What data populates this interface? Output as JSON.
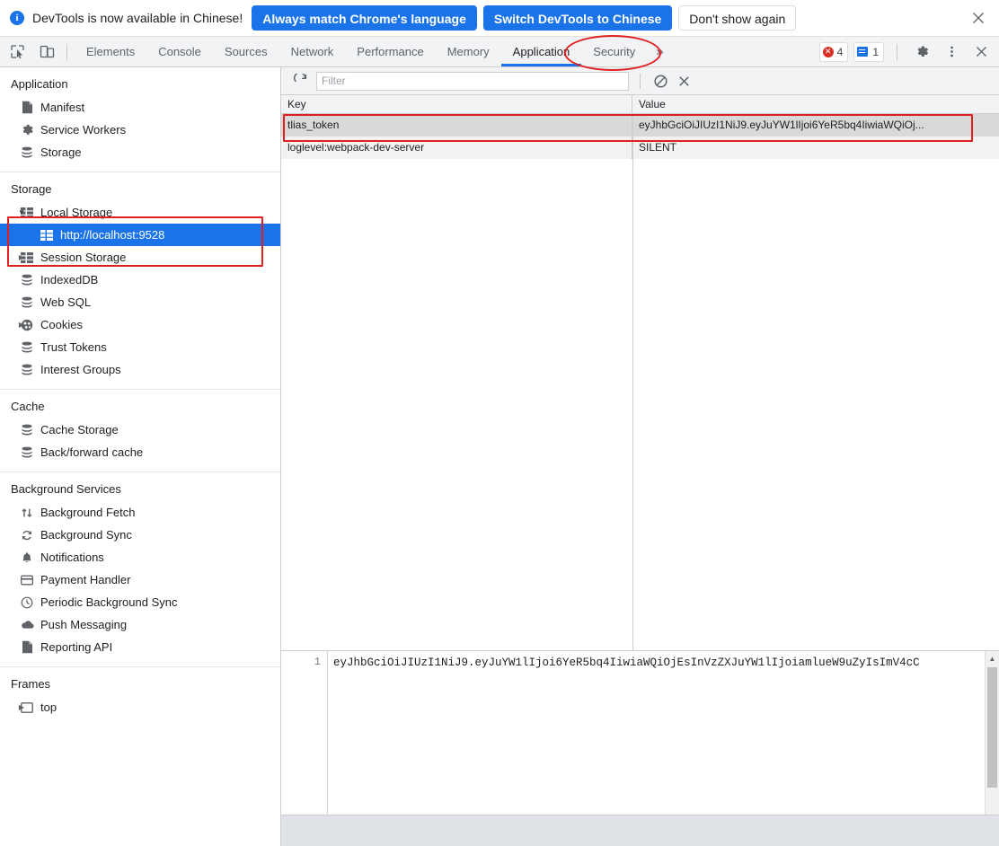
{
  "notification": {
    "icon": "info-icon",
    "message": "DevTools is now available in Chinese!",
    "buttons": [
      {
        "label": "Always match Chrome's language",
        "style": "primary"
      },
      {
        "label": "Switch DevTools to Chinese",
        "style": "primary"
      },
      {
        "label": "Don't show again",
        "style": "secondary"
      }
    ],
    "close_icon": "close-icon"
  },
  "toolbar": {
    "inspect_icon": "inspect-element-icon",
    "device_icon": "device-toolbar-icon",
    "tabs": [
      {
        "label": "Elements",
        "active": false
      },
      {
        "label": "Console",
        "active": false
      },
      {
        "label": "Sources",
        "active": false
      },
      {
        "label": "Network",
        "active": false
      },
      {
        "label": "Performance",
        "active": false
      },
      {
        "label": "Memory",
        "active": false
      },
      {
        "label": "Application",
        "active": true
      },
      {
        "label": "Security",
        "active": false
      }
    ],
    "more_tabs_icon": "chevron-double-right-icon",
    "error_badge": {
      "icon": "error-circle-icon",
      "count": "4"
    },
    "message_badge": {
      "icon": "message-icon",
      "count": "1"
    },
    "settings_icon": "gear-icon",
    "menu_icon": "kebab-menu-icon",
    "close_icon": "close-icon"
  },
  "sidebar": {
    "sections": [
      {
        "title": "Application",
        "items": [
          {
            "label": "Manifest",
            "icon": "manifest-file-icon",
            "indent": 1,
            "arrow": "",
            "selected": false
          },
          {
            "label": "Service Workers",
            "icon": "gear-icon",
            "indent": 1,
            "arrow": "",
            "selected": false
          },
          {
            "label": "Storage",
            "icon": "database-icon",
            "indent": 1,
            "arrow": "",
            "selected": false
          }
        ]
      },
      {
        "title": "Storage",
        "items": [
          {
            "label": "Local Storage",
            "icon": "table-grid-icon",
            "indent": 1,
            "arrow": "down",
            "selected": false
          },
          {
            "label": "http://localhost:9528",
            "icon": "table-grid-icon",
            "indent": 2,
            "arrow": "",
            "selected": true
          },
          {
            "label": "Session Storage",
            "icon": "table-grid-icon",
            "indent": 1,
            "arrow": "right",
            "selected": false
          },
          {
            "label": "IndexedDB",
            "icon": "database-icon",
            "indent": 1,
            "arrow": "",
            "selected": false
          },
          {
            "label": "Web SQL",
            "icon": "database-icon",
            "indent": 1,
            "arrow": "",
            "selected": false
          },
          {
            "label": "Cookies",
            "icon": "cookie-icon",
            "indent": 1,
            "arrow": "right",
            "selected": false
          },
          {
            "label": "Trust Tokens",
            "icon": "database-icon",
            "indent": 1,
            "arrow": "",
            "selected": false
          },
          {
            "label": "Interest Groups",
            "icon": "database-icon",
            "indent": 1,
            "arrow": "",
            "selected": false
          }
        ]
      },
      {
        "title": "Cache",
        "items": [
          {
            "label": "Cache Storage",
            "icon": "database-icon",
            "indent": 1,
            "arrow": "",
            "selected": false
          },
          {
            "label": "Back/forward cache",
            "icon": "database-icon",
            "indent": 1,
            "arrow": "",
            "selected": false
          }
        ]
      },
      {
        "title": "Background Services",
        "items": [
          {
            "label": "Background Fetch",
            "icon": "arrows-updown-icon",
            "indent": 1,
            "arrow": "",
            "selected": false
          },
          {
            "label": "Background Sync",
            "icon": "sync-icon",
            "indent": 1,
            "arrow": "",
            "selected": false
          },
          {
            "label": "Notifications",
            "icon": "bell-icon",
            "indent": 1,
            "arrow": "",
            "selected": false
          },
          {
            "label": "Payment Handler",
            "icon": "credit-card-icon",
            "indent": 1,
            "arrow": "",
            "selected": false
          },
          {
            "label": "Periodic Background Sync",
            "icon": "clock-icon",
            "indent": 1,
            "arrow": "",
            "selected": false
          },
          {
            "label": "Push Messaging",
            "icon": "cloud-icon",
            "indent": 1,
            "arrow": "",
            "selected": false
          },
          {
            "label": "Reporting API",
            "icon": "file-icon",
            "indent": 1,
            "arrow": "",
            "selected": false
          }
        ]
      },
      {
        "title": "Frames",
        "items": [
          {
            "label": "top",
            "icon": "frame-icon",
            "indent": 1,
            "arrow": "right",
            "selected": false
          }
        ]
      }
    ]
  },
  "filter_bar": {
    "refresh_icon": "refresh-icon",
    "filter_placeholder": "Filter",
    "filter_value": "",
    "clear_all_icon": "no-entry-icon",
    "delete_selected_icon": "close-x-icon"
  },
  "storage_table": {
    "columns": [
      "Key",
      "Value"
    ],
    "rows": [
      {
        "key": "tlias_token",
        "value": "eyJhbGciOiJIUzI1NiJ9.eyJuYW1lIjoi6YeR5bq4IiwiaWQiOj...",
        "selected": true
      },
      {
        "key": "loglevel:webpack-dev-server",
        "value": "SILENT",
        "selected": false
      }
    ]
  },
  "preview": {
    "line_number": "1",
    "content": "eyJhbGciOiJIUzI1NiJ9.eyJuYW1lIjoi6YeR5bq4IiwiaWQiOjEsInVzZXJuYW1lIjoiamlueW9uZyIsImV4cC"
  },
  "colors": {
    "accent_blue": "#1a73e8",
    "annotation_red": "#e02020",
    "selection_gray": "#d9d9d9",
    "toolbar_gray": "#f1f3f4"
  }
}
